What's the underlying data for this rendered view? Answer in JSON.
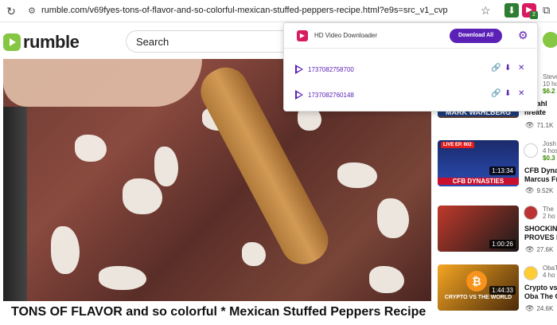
{
  "browser": {
    "url": "rumble.com/v69fyes-tons-of-flavor-and-so-colorful-mexican-stuffed-peppers-recipe.html?e9s=src_v1_cvp"
  },
  "header": {
    "logo_text": "rumble",
    "search_placeholder": "Search"
  },
  "video": {
    "title": "TONS OF FLAVOR and so colorful * Mexican Stuffed Peppers Recipe"
  },
  "popup": {
    "title": "HD Video Downloader",
    "download_all_label": "Download All",
    "items": [
      {
        "name": "1737082758700"
      },
      {
        "name": "1737082760148"
      }
    ]
  },
  "sidebar": {
    "items": [
      {
        "channel": "Steve",
        "time": "10 ho",
        "price": "$6.2",
        "title_1": "k Wahl",
        "title_2": "hreate",
        "views": "71.1K",
        "thumb_text": "MARK WAHLBERG"
      },
      {
        "channel": "Josh",
        "time": "4 hos",
        "price": "$0.3",
        "title_1": "CFB Dynas",
        "title_2": "Marcus Fr",
        "views": "9.52K",
        "duration": "1:13:34",
        "live": "LIVE  EP. 602",
        "thumb_text": "CFB DYNASTIES"
      },
      {
        "channel": "The",
        "time": "2 ho",
        "price": "",
        "title_1": "SHOCKING",
        "title_2": "PROVES L",
        "views": "27.6K",
        "duration": "1:00:26"
      },
      {
        "channel": "ObaT",
        "time": "4 ho",
        "price": "",
        "title_1": "Crypto vs",
        "title_2": "Oba The G",
        "views": "24.6K",
        "duration": "1:44:33",
        "thumb_text": "CRYPTO VS THE WORLD"
      }
    ]
  },
  "colors": {
    "accent": "#5b21b6",
    "rumble_green": "#85c742"
  }
}
